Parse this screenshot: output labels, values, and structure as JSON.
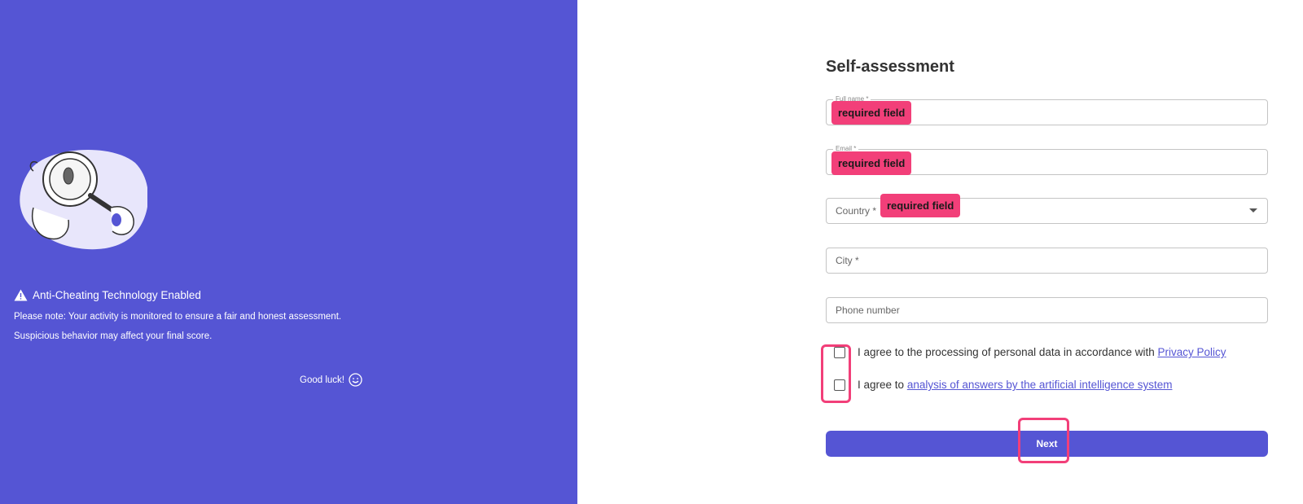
{
  "left_panel": {
    "notice_title": "Anti-Cheating Technology Enabled",
    "notice_line1": "Please note: Your activity is monitored to ensure a fair and honest assessment.",
    "notice_line2": "Suspicious behavior may affect your final score.",
    "good_luck": "Good luck!",
    "icons": [
      "magnifier-mascot-illustration",
      "warning-icon",
      "smiley-icon"
    ]
  },
  "form": {
    "title": "Self-assessment",
    "fields": {
      "full_name": {
        "label": "Full name *",
        "error": "required field"
      },
      "email": {
        "label": "Email *",
        "error": "required field"
      },
      "country": {
        "label": "Country *",
        "error": "required field"
      },
      "city": {
        "label": "City *"
      },
      "phone": {
        "label": "Phone number"
      }
    },
    "consent1": {
      "text": "I agree to the processing of personal data in accordance with",
      "link": "Privacy Policy"
    },
    "consent2": {
      "text": "I agree to",
      "link": "analysis of answers by the artificial intelligence system"
    },
    "next_label": "Next"
  },
  "colors": {
    "brand": "#5555d4",
    "error": "#f23f79",
    "white": "#ffffff"
  }
}
